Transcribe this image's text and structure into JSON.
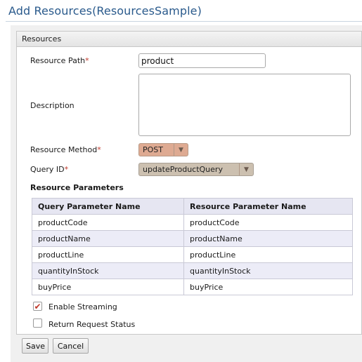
{
  "page": {
    "title": "Add  Resources(ResourcesSample)"
  },
  "panel": {
    "header": "Resources"
  },
  "form": {
    "resource_path": {
      "label": "Resource Path",
      "required_mark": "*",
      "value": "product"
    },
    "description": {
      "label": "Description",
      "value": ""
    },
    "resource_method": {
      "label": "Resource Method",
      "required_mark": "*",
      "selected": "POST"
    },
    "query_id": {
      "label": "Query ID",
      "required_mark": "*",
      "selected": "updateProductQuery"
    }
  },
  "resource_parameters": {
    "title": "Resource Parameters",
    "columns": [
      "Query Parameter Name",
      "Resource Parameter Name"
    ],
    "rows": [
      [
        "productCode",
        "productCode"
      ],
      [
        "productName",
        "productName"
      ],
      [
        "productLine",
        "productLine"
      ],
      [
        "quantityInStock",
        "quantityInStock"
      ],
      [
        "buyPrice",
        "buyPrice"
      ]
    ]
  },
  "options": {
    "enable_streaming": {
      "label": "Enable Streaming",
      "checked": true
    },
    "return_request_status": {
      "label": "Return Request Status",
      "checked": false
    }
  },
  "buttons": {
    "save": "Save",
    "cancel": "Cancel"
  },
  "colors": {
    "title": "#2a5a8c",
    "required": "#c0392b",
    "method_select": "#deaa92",
    "table_header": "#e6e6f2"
  },
  "icons": {
    "dropdown": "triangle-down-icon",
    "check": "checkmark-icon"
  }
}
